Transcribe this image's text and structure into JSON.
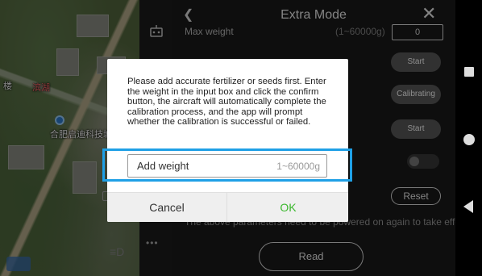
{
  "map": {
    "labels": [
      "滨湖",
      "合肥启迪科技城",
      "楼"
    ],
    "loc_icon": "location-pin-icon"
  },
  "panel": {
    "title": "Extra Mode",
    "back_icon": "chevron-left-icon",
    "close_icon": "close-icon",
    "max_weight_label": "Max weight",
    "max_weight_hint": "(1~60000g)",
    "max_weight_value": "0",
    "start_label_1": "Start",
    "calibrating_label": "Calibrating",
    "start_label_2": "Start",
    "reset_label": "Reset",
    "notice": "The above parameters need to be powered on again to take effect",
    "read_label": "Read"
  },
  "dialog": {
    "message": "Please add accurate fertilizer or seeds first. Enter the weight in the input box and click the confirm button, the aircraft will automatically complete the calibration process, and the app will prompt whether the calibration is successful or failed.",
    "input_placeholder": "Add weight",
    "input_range": "1~60000g",
    "cancel_label": "Cancel",
    "ok_label": "OK",
    "ok_color": "#3bb82e",
    "highlight_color": "#1fa0e6"
  },
  "system_nav": {
    "recent_icon": "square-icon",
    "home_icon": "circle-icon",
    "back_icon": "triangle-back-icon"
  }
}
